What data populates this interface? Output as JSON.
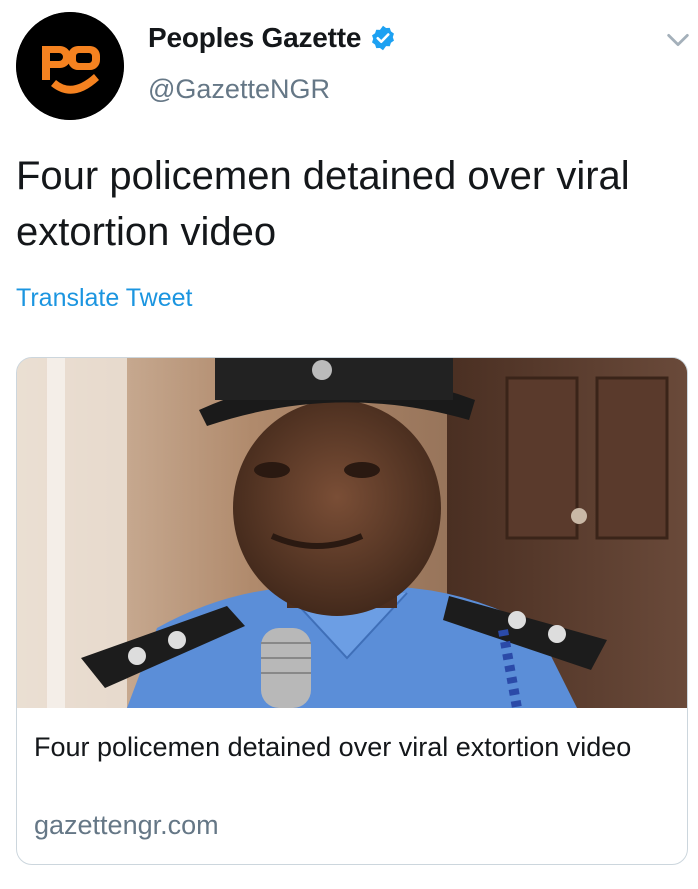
{
  "account": {
    "display_name": "Peoples Gazette",
    "handle": "@GazetteNGR",
    "avatar_icon": "peoples-gazette-logo",
    "verified_icon": "verified-badge-icon"
  },
  "menu": {
    "icon": "chevron-down-icon"
  },
  "tweet": {
    "text": "Four policemen detained over viral extortion video",
    "translate_label": "Translate Tweet"
  },
  "card": {
    "image_icon": "article-photo-police-officer",
    "title": "Four policemen detained over viral extortion video",
    "domain": "gazettengr.com"
  },
  "colors": {
    "link_blue": "#1b95e0",
    "secondary_text": "#657786",
    "primary_text": "#14171a",
    "card_border": "#ccd6dd",
    "logo_orange": "#f58220"
  }
}
